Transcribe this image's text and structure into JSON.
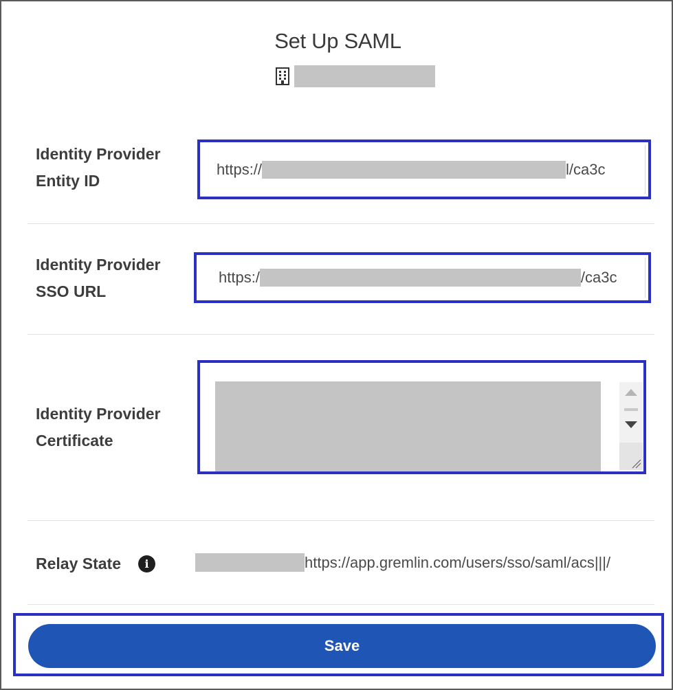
{
  "dialog": {
    "title": "Set Up SAML"
  },
  "fields": {
    "entity_id": {
      "label_line1": "Identity Provider",
      "label_line2": "Entity ID",
      "value_prefix": "https://",
      "value_suffix": "l/ca3c"
    },
    "sso_url": {
      "label_line1": "Identity Provider",
      "label_line2": "SSO URL",
      "value_prefix": "https:/",
      "value_suffix": "/ca3c"
    },
    "certificate": {
      "label_line1": "Identity Provider",
      "label_line2": "Certificate"
    },
    "relay_state": {
      "label": "Relay State",
      "info_glyph": "i",
      "value_suffix": "https://app.gremlin.com/users/sso/saml/acs|||/"
    }
  },
  "actions": {
    "save_label": "Save"
  },
  "colors": {
    "highlight": "#2c2fc4",
    "primary_button": "#1f56b5",
    "redaction": "#c4c4c4"
  }
}
